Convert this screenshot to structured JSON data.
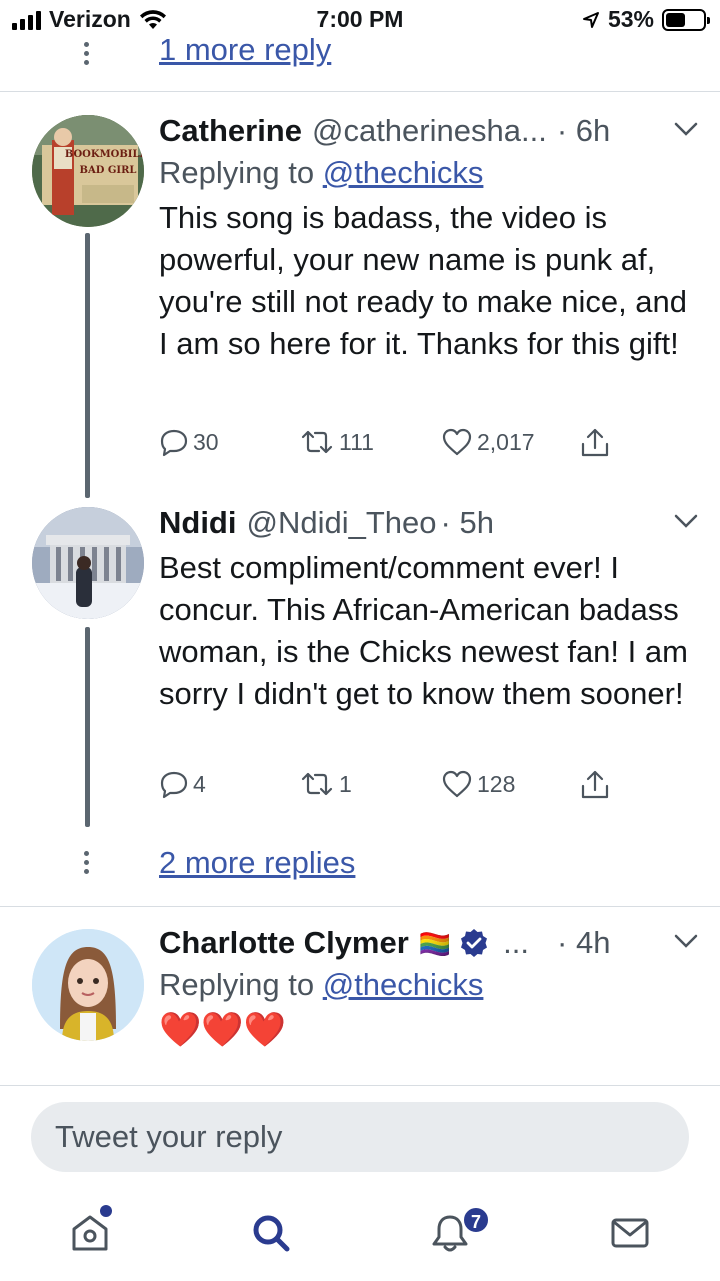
{
  "status_bar": {
    "carrier": "Verizon",
    "time": "7:00 PM",
    "battery": "53%",
    "battery_level": 0.53
  },
  "top_thread": {
    "more_replies": "1 more reply"
  },
  "tweets": [
    {
      "name": "Catherine",
      "handle": "@catherinesha...",
      "time": "· 6h",
      "replying_prefix": "Replying to",
      "replying_to": "@thechicks",
      "text": "This song is badass, the video is powerful, your new name is punk af, you're still not ready to make nice, and I am so here for it. Thanks for this gift!",
      "replies": "30",
      "retweets": "111",
      "likes": "2,017",
      "avatar_text": [
        "BOOKMOBILE",
        "BAD GIRL"
      ]
    },
    {
      "name": "Ndidi",
      "handle": "@Ndidi_Theo",
      "time": "· 5h",
      "text": "Best compliment/comment ever! I concur. This African-American badass woman, is the Chicks newest fan! I am sorry I didn't get to know them sooner!",
      "replies": "4",
      "retweets": "1",
      "likes": "128"
    },
    {
      "name": "Charlotte Clymer",
      "name_suffix": "🏳️‍🌈",
      "ellipsis": "...",
      "time": "· 4h",
      "replying_prefix": "Replying to",
      "replying_to": "@thechicks",
      "text": "❤️❤️❤️"
    }
  ],
  "thread_more": "2 more replies",
  "reply_bar": {
    "placeholder": "Tweet your reply"
  },
  "tab_bar": {
    "notifications_count": "7",
    "items": [
      "home-icon",
      "search-icon",
      "bell-icon",
      "mail-icon"
    ]
  },
  "colors": {
    "link": "#3a57a8",
    "text": "#14171a",
    "secondary": "#4b545d",
    "badge": "#2a3b8f"
  }
}
